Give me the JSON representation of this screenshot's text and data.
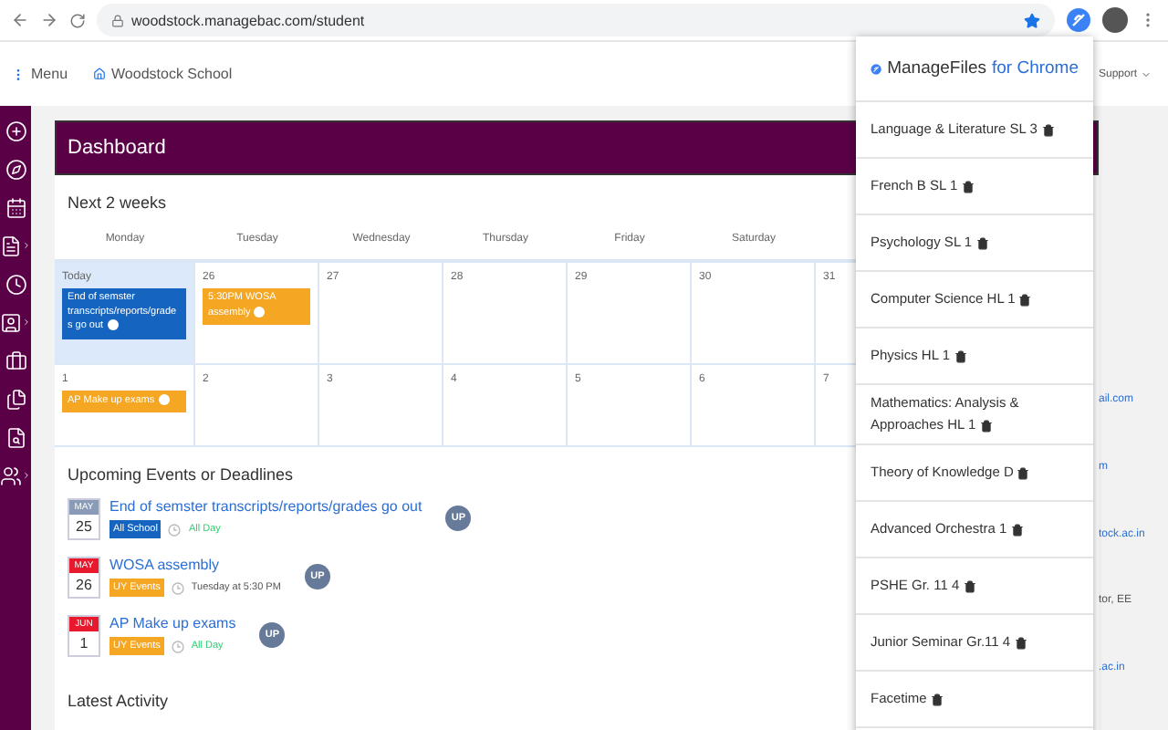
{
  "browser": {
    "url": "woodstock.managebac.com/student"
  },
  "header": {
    "menu_label": "Menu",
    "school": "Woodstock School",
    "support": "Support"
  },
  "dashboard": {
    "title": "Dashboard",
    "calendar_title": "Next 2 weeks",
    "weekdays": [
      "Monday",
      "Tuesday",
      "Wednesday",
      "Thursday",
      "Friday",
      "Saturday"
    ],
    "weeks": [
      [
        {
          "day": "Today",
          "today": true,
          "events": [
            {
              "text": "End of semster transcripts/reports/grades go out",
              "color": "#1565c0"
            }
          ]
        },
        {
          "day": "26",
          "today": false,
          "events": [
            {
              "text": "5:30PM WOSA assembly",
              "color": "#f5a623"
            }
          ]
        },
        {
          "day": "27",
          "today": false
        },
        {
          "day": "28",
          "today": false
        },
        {
          "day": "29",
          "today": false
        },
        {
          "day": "30",
          "today": false
        },
        {
          "day": "31",
          "today": false
        }
      ],
      [
        {
          "day": "1",
          "today": false,
          "events": [
            {
              "text": "AP Make up exams",
              "color": "#f5a623"
            }
          ]
        },
        {
          "day": "2",
          "today": false
        },
        {
          "day": "3",
          "today": false
        },
        {
          "day": "4",
          "today": false
        },
        {
          "day": "5",
          "today": false
        },
        {
          "day": "6",
          "today": false
        },
        {
          "day": "7",
          "today": false
        }
      ]
    ],
    "upcoming_title": "Upcoming Events or Deadlines",
    "upcoming": [
      {
        "month": {
          "text": "MAY",
          "color": "#8a9bb8"
        },
        "day": "25",
        "title": "End of semster transcripts/reports/grades go out",
        "tag": {
          "text": "All School",
          "color": "#1565c0"
        },
        "time": {
          "text": "All Day",
          "color": "#2ecc71"
        },
        "avatar": "UP"
      },
      {
        "month": {
          "text": "MAY",
          "color": "#e8192c"
        },
        "day": "26",
        "title": "WOSA assembly",
        "tag": {
          "text": "UY Events",
          "color": "#f5a623"
        },
        "time": {
          "text": "Tuesday at 5:30 PM",
          "color": "#555555"
        },
        "avatar": "UP"
      },
      {
        "month": {
          "text": "JUN",
          "color": "#e8192c"
        },
        "day": "1",
        "title": "AP Make up exams",
        "tag": {
          "text": "UY Events",
          "color": "#f5a623"
        },
        "time": {
          "text": "All Day",
          "color": "#2ecc71"
        },
        "avatar": "UP"
      }
    ],
    "latest_title": "Latest Activity"
  },
  "right_fragments": [
    {
      "text": "ail.com",
      "kind": "link"
    },
    {
      "text": "m",
      "kind": "link"
    },
    {
      "text": "tock.ac.in",
      "kind": "link"
    },
    {
      "text": "tor, EE",
      "kind": "text"
    },
    {
      "text": ".ac.in",
      "kind": "link"
    }
  ],
  "popup": {
    "title": "ManageFiles",
    "title_suffix": "for Chrome",
    "items": [
      "Language & Literature SL 3",
      "French B SL 1",
      "Psychology SL 1",
      "Computer Science HL 1",
      "Physics HL 1",
      "Mathematics: Analysis & Approaches HL 1",
      "Theory of Knowledge D",
      "Advanced Orchestra 1",
      "PSHE Gr. 11 4",
      "Junior Seminar Gr.11 4",
      "Facetime"
    ]
  }
}
